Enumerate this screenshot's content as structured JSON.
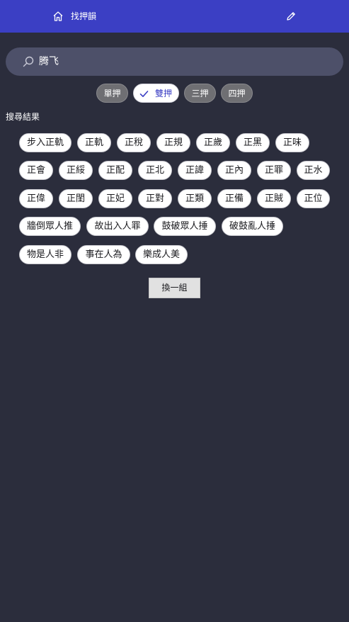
{
  "appbar": {
    "title": "找押韻",
    "home_icon": "home-icon",
    "edit_icon": "pencil-icon"
  },
  "search": {
    "icon": "search-icon",
    "value": "腾飞"
  },
  "modes": [
    {
      "label": "單押",
      "selected": false
    },
    {
      "label": "雙押",
      "selected": true
    },
    {
      "label": "三押",
      "selected": false
    },
    {
      "label": "四押",
      "selected": false
    }
  ],
  "results_label": "搜尋結果",
  "results": [
    [
      "步入正軌",
      "正軌",
      "正稅",
      "正規",
      "正歲",
      "正黑",
      "正味"
    ],
    [
      "正會",
      "正綏",
      "正配",
      "正北",
      "正諱",
      "正內",
      "正罪",
      "正水"
    ],
    [
      "正偉",
      "正閨",
      "正妃",
      "正對",
      "正類",
      "正備",
      "正賊",
      "正位"
    ],
    [
      "牆倒眾人推",
      "故出入人罪",
      "鼓破眾人捶",
      "破鼓亂人捶"
    ],
    [
      "物是人非",
      "事在人為",
      "樂成人美"
    ]
  ],
  "refresh_label": "換一組",
  "colors": {
    "appbar": "#3b3fc4",
    "background": "#2b2d3c",
    "search_bg": "#4d5069",
    "chip_bg": "#ffffff",
    "mode_off_bg": "#6f6f73"
  }
}
